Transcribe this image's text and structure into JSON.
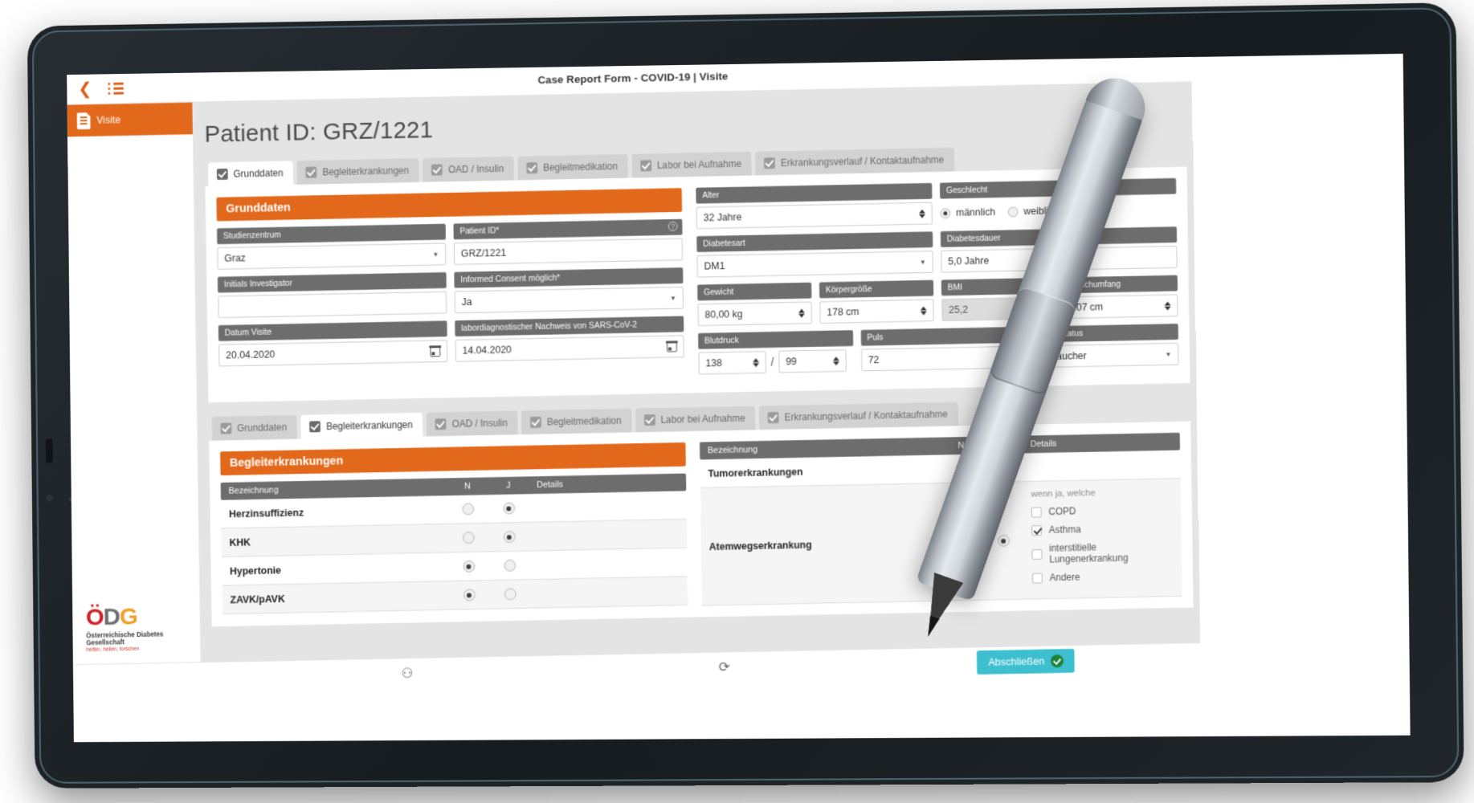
{
  "window": {
    "title": "Case Report Form - COVID-19 | Visite",
    "back_icon": "chevron-left-icon",
    "menu_icon": "list-icon"
  },
  "sidebar": {
    "items": [
      {
        "label": "Visite",
        "icon": "document-icon"
      }
    ],
    "logo": {
      "o": "Ö",
      "d": "D",
      "g": "G",
      "sub": "Österreichische Diabetes Gesellschaft",
      "sub2": "helfen, heilen, forschen"
    }
  },
  "main": {
    "page_title": "Patient ID: GRZ/1221",
    "tabs_top": [
      {
        "label": "Grunddaten",
        "active": true
      },
      {
        "label": "Begleiterkrankungen",
        "active": false
      },
      {
        "label": "OAD / Insulin",
        "active": false
      },
      {
        "label": "Begleitmedikation",
        "active": false
      },
      {
        "label": "Labor bei Aufnahme",
        "active": false
      },
      {
        "label": "Erkrankungsverlauf / Kontaktaufnahme",
        "active": false
      }
    ],
    "tabs_bottom": [
      {
        "label": "Grunddaten",
        "active": false
      },
      {
        "label": "Begleiterkrankungen",
        "active": true
      },
      {
        "label": "OAD / Insulin",
        "active": false
      },
      {
        "label": "Begleitmedikation",
        "active": false
      },
      {
        "label": "Labor bei Aufnahme",
        "active": false
      },
      {
        "label": "Erkrankungsverlauf / Kontaktaufnahme",
        "active": false
      }
    ]
  },
  "grunddaten": {
    "section_title": "Grunddaten",
    "fields": {
      "studienzentrum": {
        "label": "Studienzentrum",
        "value": "Graz",
        "type": "select"
      },
      "patient_id": {
        "label": "Patient ID*",
        "value": "GRZ/1221",
        "type": "text",
        "help": "?"
      },
      "initials": {
        "label": "Initials Investigator",
        "value": "",
        "type": "text"
      },
      "consent": {
        "label": "Informed Consent möglich*",
        "value": "Ja",
        "type": "select"
      },
      "datum_visite": {
        "label": "Datum Visite",
        "value": "20.04.2020",
        "type": "date"
      },
      "nachweis": {
        "label": "labordiagnostischer Nachweis von SARS-CoV-2",
        "value": "14.04.2020",
        "type": "date"
      },
      "alter": {
        "label": "Alter",
        "value": "32 Jahre",
        "type": "spinner"
      },
      "geschlecht": {
        "label": "Geschlecht",
        "options": [
          "männlich",
          "weiblich"
        ],
        "selected": "männlich"
      },
      "diabetesart": {
        "label": "Diabetesart",
        "value": "DM1",
        "type": "select"
      },
      "diabetesdauer": {
        "label": "Diabetesdauer",
        "value": "5,0 Jahre",
        "type": "text"
      },
      "gewicht": {
        "label": "Gewicht",
        "value": "80,00 kg",
        "type": "spinner"
      },
      "koerpergroesse": {
        "label": "Körpergröße",
        "value": "178 cm",
        "type": "spinner"
      },
      "bmi": {
        "label": "BMI",
        "value": "25,2",
        "type": "readonly"
      },
      "bauchumfang": {
        "label": "Bauchumfang",
        "value": "107 cm",
        "type": "spinner"
      },
      "blutdruck": {
        "label": "Blutdruck",
        "systolic": "138",
        "diastolic": "99",
        "separator": "/"
      },
      "puls": {
        "label": "Puls",
        "value": "72",
        "type": "spinner"
      },
      "raucherstatus": {
        "label": "Raucherstatus",
        "value": "Nichtraucher",
        "type": "select"
      }
    }
  },
  "begleiterkrankungen": {
    "section_title": "Begleiterkrankungen",
    "columns": {
      "name": "Bezeichnung",
      "n": "N",
      "j": "J",
      "details": "Details"
    },
    "rows_left": [
      {
        "name": "Herzinsuffizienz",
        "n": false,
        "j": true
      },
      {
        "name": "KHK",
        "n": false,
        "j": true
      },
      {
        "name": "Hypertonie",
        "n": true,
        "j": false
      },
      {
        "name": "ZAVK/pAVK",
        "n": true,
        "j": false
      }
    ],
    "rows_right": [
      {
        "name": "Tumorerkrankungen",
        "n": true,
        "j": false,
        "details": []
      },
      {
        "name": "Atemwegserkrankung",
        "n": false,
        "j": true,
        "details_hint": "wenn ja, welche",
        "details": [
          {
            "label": "COPD",
            "checked": false
          },
          {
            "label": "Asthma",
            "checked": true
          },
          {
            "label": "interstitielle Lungenerkrankung",
            "checked": false
          },
          {
            "label": "Andere",
            "checked": false
          }
        ]
      }
    ]
  },
  "footer": {
    "icons": [
      {
        "name": "users-icon",
        "glyph": "⚇"
      },
      {
        "name": "refresh-icon",
        "glyph": "⟳"
      }
    ],
    "finish_button": {
      "label": "Abschließen",
      "icon": "check-circle-icon"
    }
  },
  "colors": {
    "accent_orange": "#e2691c",
    "label_gray": "#6d6d6d",
    "finish_teal": "#3dbfcf",
    "logo_red": "#cf2027",
    "logo_gray": "#6d6e71",
    "logo_yellow": "#f0a02a"
  }
}
